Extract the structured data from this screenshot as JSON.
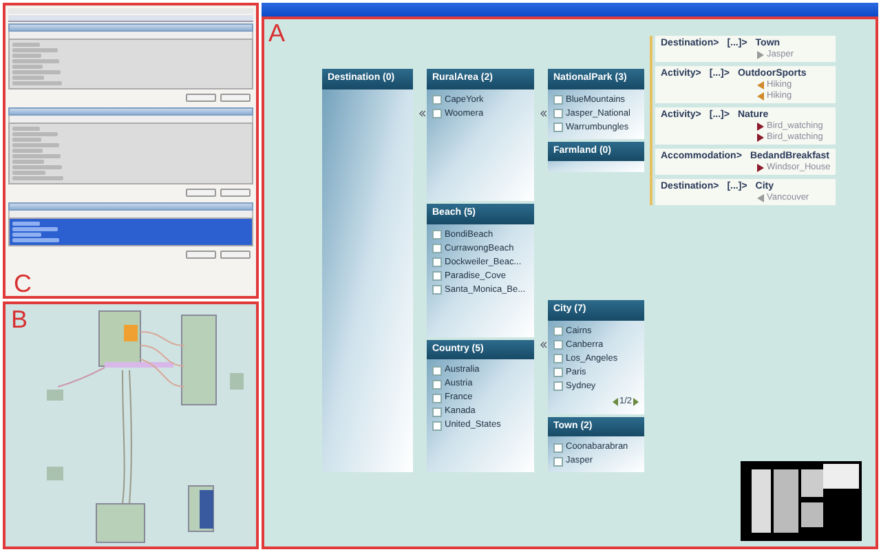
{
  "panel_labels": {
    "main": "A",
    "overview": "B",
    "controls": "C"
  },
  "facet_columns": [
    {
      "groups": [
        [
          {
            "title": "Destination (0)"
          }
        ]
      ]
    },
    {
      "groups": [
        [
          {
            "title": "RuralArea (2)",
            "items": [
              {
                "label": "CapeYork",
                "checked": false
              },
              {
                "label": "Woomera",
                "checked": false
              }
            ]
          },
          {
            "title": "Beach (5)",
            "items": [
              {
                "label": "BondiBeach",
                "checked": false
              },
              {
                "label": "CurrawongBeach",
                "checked": false
              },
              {
                "label": "Dockweiler_Beac...",
                "checked": false
              },
              {
                "label": "Paradise_Cove",
                "checked": false
              },
              {
                "label": "Santa_Monica_Be...",
                "checked": false
              }
            ]
          },
          {
            "title": "Country (5)",
            "items": [
              {
                "label": "Australia",
                "checked": false
              },
              {
                "label": "Austria",
                "checked": false
              },
              {
                "label": "France",
                "checked": false
              },
              {
                "label": "Kanada",
                "checked": false
              },
              {
                "label": "United_States",
                "checked": false
              }
            ]
          }
        ]
      ]
    },
    {
      "groups": [
        [
          {
            "title": "NationalPark (3)",
            "items": [
              {
                "label": "BlueMountains",
                "checked": false
              },
              {
                "label": "Jasper_National",
                "checked": false
              },
              {
                "label": "Warrumbungles",
                "checked": false
              }
            ]
          },
          {
            "title": "Farmland (0)"
          }
        ],
        [
          {
            "title": "City (7)",
            "items": [
              {
                "label": "Cairns",
                "checked": false
              },
              {
                "label": "Canberra",
                "checked": false
              },
              {
                "label": "Los_Angeles",
                "checked": false
              },
              {
                "label": "Paris",
                "checked": false
              },
              {
                "label": "Sydney",
                "checked": false
              }
            ],
            "pager": "1/2"
          },
          {
            "title": "Town (2)",
            "items": [
              {
                "label": "Coonabarabran",
                "checked": false
              },
              {
                "label": "Jasper",
                "checked": false
              }
            ]
          }
        ]
      ]
    }
  ],
  "paths": [
    {
      "path": "Destination>",
      "ellipsis": "[...]>",
      "target": "Town",
      "values": [
        {
          "text": "Jasper",
          "kind": "right",
          "color": "#9a9a9a"
        }
      ]
    },
    {
      "path": "Activity>",
      "ellipsis": "[...]>",
      "target": "OutdoorSports",
      "values": [
        {
          "text": "Hiking",
          "kind": "left",
          "color": "#d08a2a"
        },
        {
          "text": "Hiking",
          "kind": "left",
          "color": "#d08a2a"
        }
      ]
    },
    {
      "path": "Activity>",
      "ellipsis": "[...]>",
      "target": "Nature",
      "values": [
        {
          "text": "Bird_watching",
          "kind": "right",
          "color": "#8b1a2a"
        },
        {
          "text": "Bird_watching",
          "kind": "right",
          "color": "#8b1a2a"
        }
      ]
    },
    {
      "path": "Accommodation>",
      "target": "BedandBreakfast",
      "values": [
        {
          "text": "Windsor_House",
          "kind": "right",
          "color": "#8b1a2a"
        }
      ]
    },
    {
      "path": "Destination>",
      "ellipsis": "[...]>",
      "target": "City",
      "values": [
        {
          "text": "Vancouver",
          "kind": "left",
          "color": "#9a9a9a"
        }
      ]
    }
  ]
}
